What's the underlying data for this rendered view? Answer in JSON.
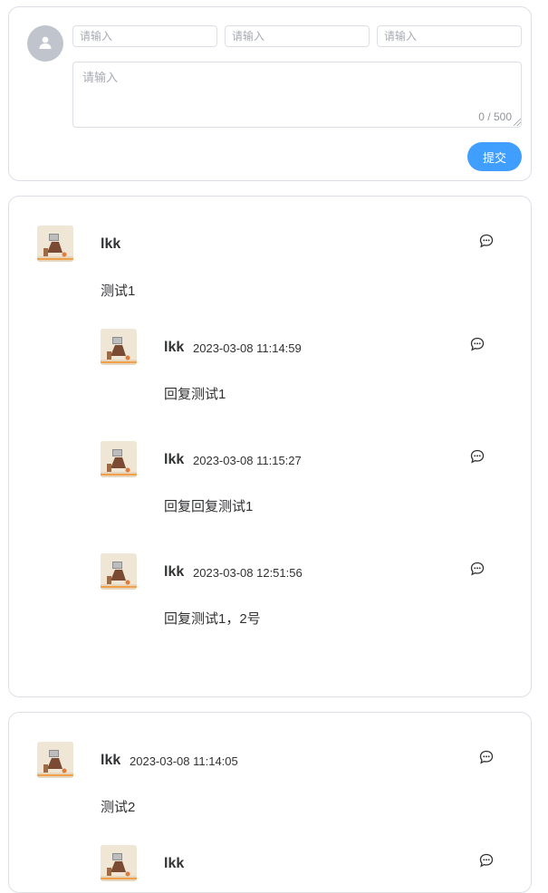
{
  "form": {
    "input1_placeholder": "请输入",
    "input2_placeholder": "请输入",
    "input3_placeholder": "请输入",
    "textarea_placeholder": "请输入",
    "char_count": "0 / 500",
    "submit_label": "提交"
  },
  "comments": [
    {
      "username": "lkk",
      "time": "",
      "content": "测试1",
      "replies": [
        {
          "username": "lkk",
          "time": "2023-03-08 11:14:59",
          "content": "回复测试1"
        },
        {
          "username": "lkk",
          "time": "2023-03-08 11:15:27",
          "content": "回复回复测试1"
        },
        {
          "username": "lkk",
          "time": "2023-03-08 12:51:56",
          "content": "回复测试1，2号"
        }
      ]
    },
    {
      "username": "lkk",
      "time": "2023-03-08 11:14:05",
      "content": "测试2",
      "replies": [
        {
          "username": "lkk",
          "time": "",
          "content": ""
        }
      ]
    }
  ],
  "colors": {
    "accent": "#409eff",
    "border": "#dcdfe6",
    "default_avatar": "#c0c4cc"
  },
  "icons": {
    "default_avatar": "user-icon",
    "reply": "chat-bubble-icon"
  }
}
